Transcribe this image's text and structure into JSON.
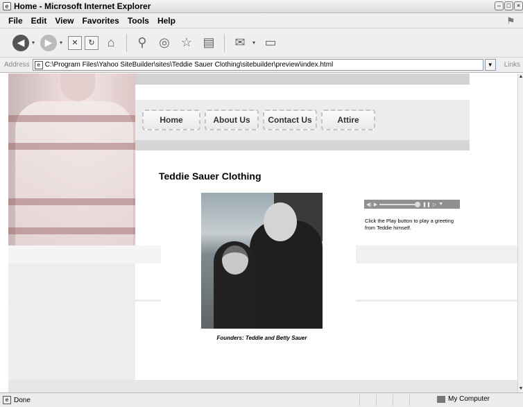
{
  "window": {
    "title": "Home - Microsoft Internet Explorer"
  },
  "menu": [
    {
      "label": "File"
    },
    {
      "label": "Edit"
    },
    {
      "label": "View"
    },
    {
      "label": "Favorites"
    },
    {
      "label": "Tools"
    },
    {
      "label": "Help"
    }
  ],
  "toolbar": {
    "icons": [
      "back-icon",
      "forward-icon",
      "stop-icon",
      "refresh-icon",
      "home-icon",
      "search-icon",
      "media-icon",
      "favorites-icon",
      "history-icon",
      "mail-icon",
      "print-icon"
    ]
  },
  "address": {
    "label": "Address",
    "url": "C:\\Program Files\\Yahoo SiteBuilder\\sites\\Teddie Sauer Clothing\\sitebuilder\\preview\\index.html",
    "links_label": "Links"
  },
  "site": {
    "nav": [
      {
        "label": "Home"
      },
      {
        "label": "About Us"
      },
      {
        "label": "Contact Us"
      },
      {
        "label": "Attire"
      }
    ],
    "heading": "Teddie Sauer Clothing",
    "photo_caption": "Founders: Teddie and Betty Sauer",
    "player_note": "Click the Play button to play a greeting from Teddie himself."
  },
  "status": {
    "text": "Done",
    "zone": "My Computer"
  }
}
